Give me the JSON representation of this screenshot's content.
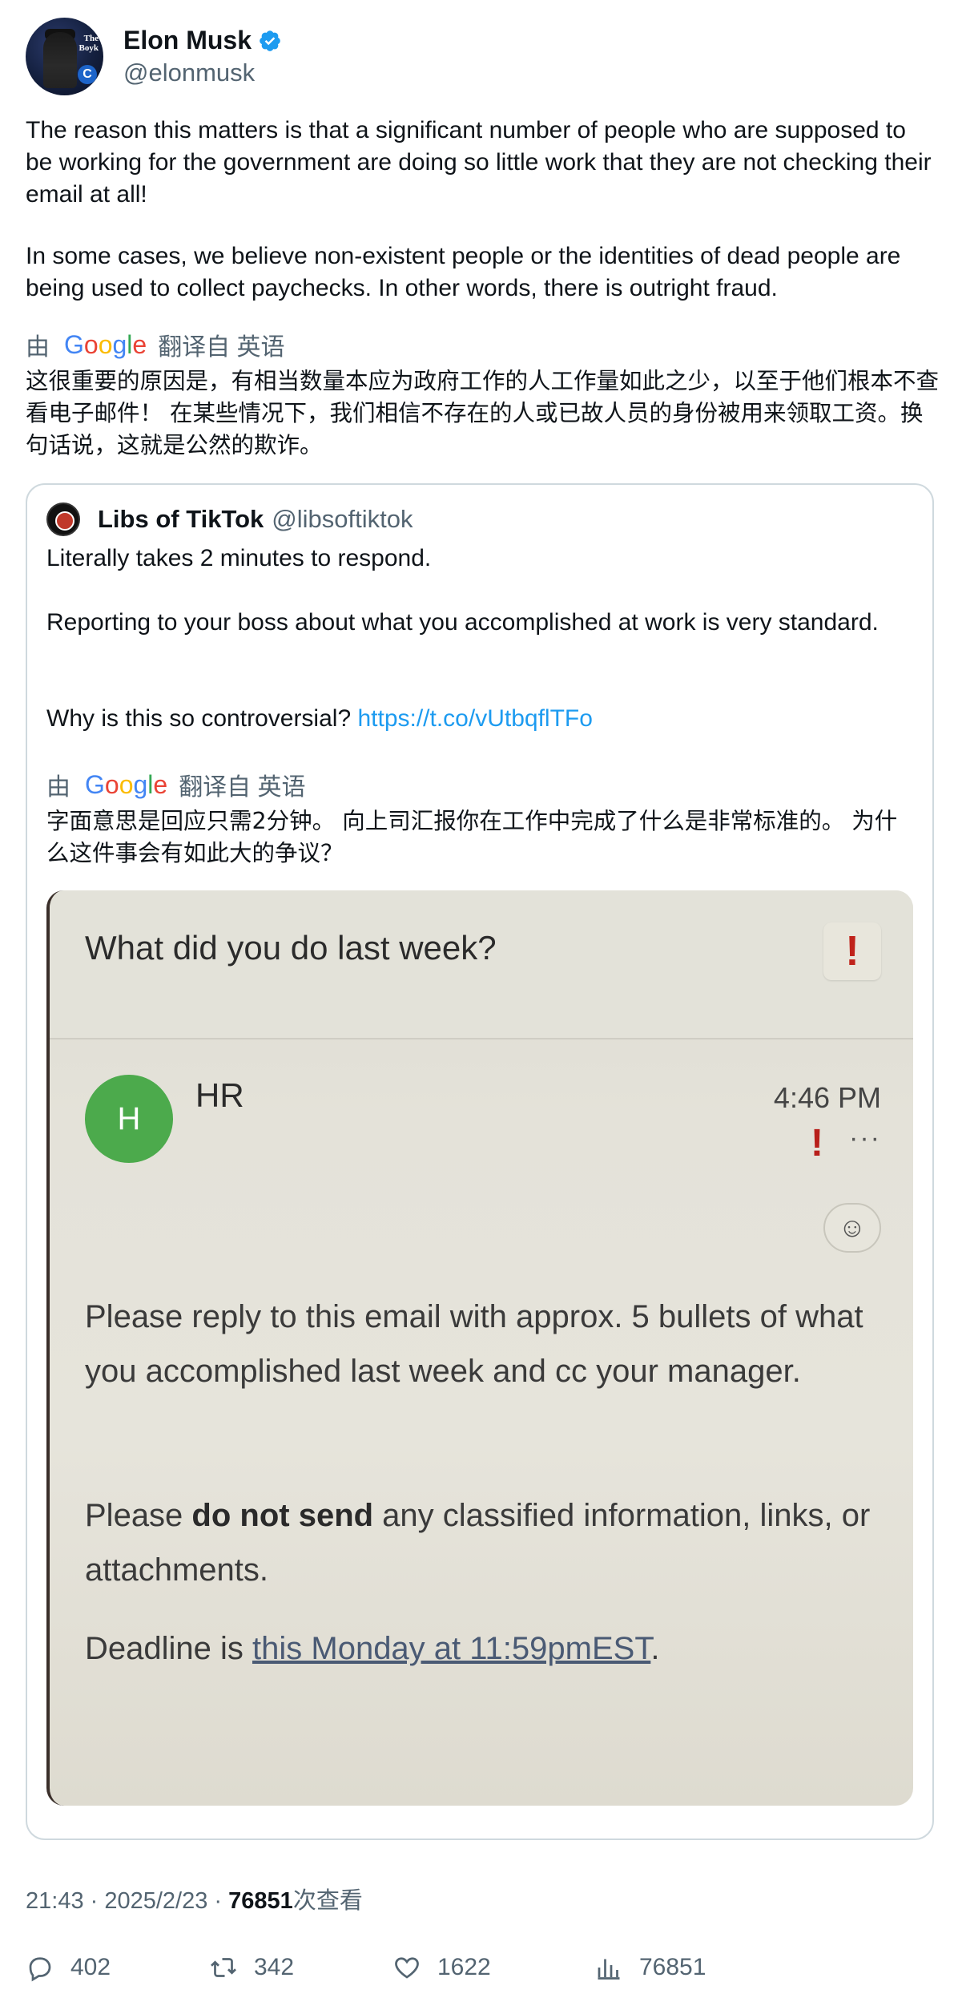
{
  "author": {
    "display_name": "Elon Musk",
    "handle": "@elonmusk",
    "avatar_text_line1": "The",
    "avatar_text_line2": "Boyk"
  },
  "tweet": {
    "paragraph1": "The reason this matters is that a significant number of people who are supposed to be working for the government are doing so little work that they are not checking their email at all!",
    "paragraph2": "In some cases, we believe non-existent people or the identities of dead people are being used to collect paychecks. In other words, there is outright fraud.",
    "translate_prefix": "由",
    "translate_suffix": "翻译自 英语",
    "translation": "这很重要的原因是，有相当数量本应为政府工作的人工作量如此之少，以至于他们根本不查看电子邮件！ 在某些情况下，我们相信不存在的人或已故人员的身份被用来领取工资。换句话说，这就是公然的欺诈。"
  },
  "quoted": {
    "display_name": "Libs of TikTok",
    "handle": "@libsoftiktok",
    "line1": "Literally takes 2 minutes to respond.",
    "line2": "Reporting to your boss about what you accomplished at work is very standard.",
    "line3_prefix": "Why is this so controversial? ",
    "link": "https://t.co/vUtbqflTFo",
    "translate_prefix": "由",
    "translate_suffix": "翻译自 英语",
    "translation": "字面意思是回应只需2分钟。 向上司汇报你在工作中完成了什么是非常标准的。 为什么这件事会有如此大的争议？"
  },
  "email_image": {
    "subject": "What did you do last week?",
    "sender_initial": "H",
    "sender": "HR",
    "time": "4:46 PM",
    "body1": "Please reply to this email with approx. 5 bullets of what you accomplished last week and cc your manager.",
    "body2_prefix": "Please ",
    "body2_bold": "do not send",
    "body2_suffix": " any classified information, links, or attachments.",
    "body3_prefix": "Deadline is ",
    "body3_link": "this Monday at 11:59pmEST",
    "body3_suffix": "."
  },
  "meta": {
    "time": "21:43",
    "sep1": " · ",
    "date": "2025/2/23",
    "sep2": " · ",
    "views": "76851",
    "views_suffix": "次查看"
  },
  "actions": {
    "replies": "402",
    "retweets": "342",
    "likes": "1622",
    "views": "76851"
  },
  "colors": {
    "link": "#1d9bf0",
    "muted": "#536471",
    "verified": "#1d9bf0",
    "hr_avatar": "#4caa4c",
    "flag": "#c0231b"
  }
}
